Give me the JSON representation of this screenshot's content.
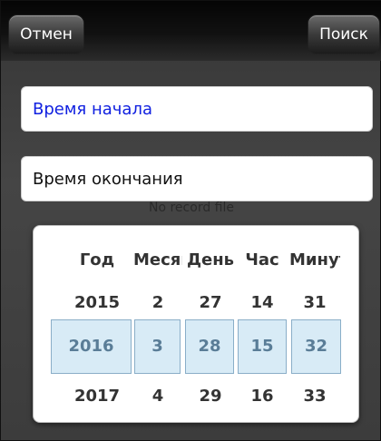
{
  "toolbar": {
    "cancel_label": "Отмен",
    "search_label": "Поиск"
  },
  "form": {
    "start_time_label": "Время начала",
    "end_time_label": "Время окончания"
  },
  "status": {
    "empty_text": "No record file"
  },
  "picker": {
    "headers": {
      "year": "Год",
      "month": "Месяц",
      "day": "День",
      "hour": "Час",
      "minute": "Минута"
    },
    "year": {
      "prev": "2015",
      "selected": "2016",
      "next": "2017"
    },
    "month": {
      "prev": "2",
      "selected": "3",
      "next": "4"
    },
    "day": {
      "prev": "27",
      "selected": "28",
      "next": "29"
    },
    "hour": {
      "prev": "14",
      "selected": "15",
      "next": "16"
    },
    "minute": {
      "prev": "31",
      "selected": "32",
      "next": "33"
    }
  },
  "colors": {
    "start_label_color": "#1020e0",
    "selection_fill": "#d8ebf6",
    "selection_border": "#8aaec8"
  }
}
